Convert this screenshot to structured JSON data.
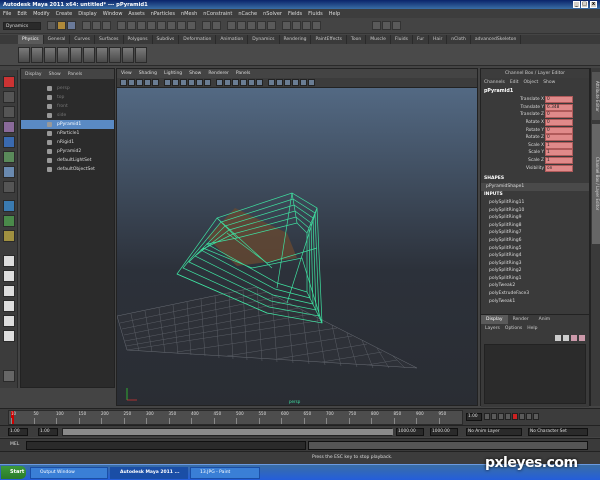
{
  "window": {
    "title": "Autodesk Maya 2011 x64: untitled*   ---   pPyramid1"
  },
  "menus": [
    "File",
    "Edit",
    "Modify",
    "Create",
    "Display",
    "Window",
    "Assets",
    "nParticles",
    "nMesh",
    "nConstraint",
    "nCache",
    "nSolver",
    "Fields",
    "Fluids",
    "Help"
  ],
  "statusline": {
    "mode": "Dynamics"
  },
  "shelf_tabs": [
    "General",
    "Curves",
    "Surfaces",
    "Polygons",
    "Subdivs",
    "Deformation",
    "Animation",
    "Dynamics",
    "Rendering",
    "PaintEffects",
    "Toon",
    "Muscle",
    "Fluids",
    "Fur",
    "Hair",
    "nCloth",
    "advancedSkeleton"
  ],
  "shelf_tabs_first": "Physics",
  "outliner": {
    "menu": [
      "Display",
      "Show",
      "Panels"
    ],
    "items": [
      {
        "label": "persp",
        "state": "dim"
      },
      {
        "label": "top",
        "state": "dim"
      },
      {
        "label": "front",
        "state": "dim"
      },
      {
        "label": "side",
        "state": "dim"
      },
      {
        "label": "pPyramid1",
        "state": "selected"
      },
      {
        "label": "nParticle1",
        "state": "normal"
      },
      {
        "label": "nRigid1",
        "state": "normal"
      },
      {
        "label": "pPyramid2",
        "state": "normal"
      },
      {
        "label": "defaultLightSet",
        "state": "normal"
      },
      {
        "label": "defaultObjectSet",
        "state": "normal"
      }
    ]
  },
  "viewport": {
    "menu": [
      "View",
      "Shading",
      "Lighting",
      "Show",
      "Renderer",
      "Panels"
    ],
    "camera_label": "persp"
  },
  "channel_box": {
    "header": "Channel Box / Layer Editor",
    "menu": [
      "Channels",
      "Edit",
      "Object",
      "Show"
    ],
    "object": "pPyramid1",
    "attributes": [
      {
        "name": "Translate X",
        "value": "0"
      },
      {
        "name": "Translate Y",
        "value": "6.348"
      },
      {
        "name": "Translate Z",
        "value": "0"
      },
      {
        "name": "Rotate X",
        "value": "0"
      },
      {
        "name": "Rotate Y",
        "value": "0"
      },
      {
        "name": "Rotate Z",
        "value": "0"
      },
      {
        "name": "Scale X",
        "value": "1"
      },
      {
        "name": "Scale Y",
        "value": "1"
      },
      {
        "name": "Scale Z",
        "value": "1"
      },
      {
        "name": "Visibility",
        "value": "on"
      }
    ],
    "shapes_label": "SHAPES",
    "shape": "pPyramidShape1",
    "inputs_label": "INPUTS",
    "inputs": [
      "polySplitRing11",
      "polySplitRing10",
      "polySplitRing9",
      "polySplitRing8",
      "polySplitRing7",
      "polySplitRing6",
      "polySplitRing5",
      "polySplitRing4",
      "polySplitRing3",
      "polySplitRing2",
      "polySplitRing1",
      "polyTweak2",
      "polyExtrudeFace3",
      "polyTweak1"
    ]
  },
  "layer_editor": {
    "tabs": [
      "Display",
      "Render",
      "Anim"
    ],
    "menu": [
      "Layers",
      "Options",
      "Help"
    ]
  },
  "side_tabs": [
    "Attribute Editor",
    "Channel Box / Layer Editor"
  ],
  "timeline": {
    "ticks": [
      "10",
      "50",
      "100",
      "150",
      "200",
      "250",
      "300",
      "350",
      "400",
      "450",
      "500",
      "550",
      "600",
      "650",
      "700",
      "750",
      "800",
      "850",
      "900",
      "950"
    ],
    "current_frame": "1.00",
    "range_start": "1.00",
    "range_start2": "1.00",
    "range_end": "1000.00",
    "range_end2": "1000.00",
    "anim_layer": "No Anim Layer",
    "character_set": "No Character Set"
  },
  "command_line": {
    "label": "MEL"
  },
  "help_line": {
    "text": "Press the ESC key to stop playback."
  },
  "taskbar": {
    "start": "Start",
    "tasks": [
      "Output Window",
      "Autodesk Maya 2011 ...",
      "13.JPG - Paint"
    ]
  },
  "watermark": "pxleyes.com",
  "colors": {
    "selection": "#5a8ac4",
    "keyed_attr": "#e08a8a",
    "wireframe": "#3fe0a0",
    "viewport_top": "#576f8b"
  }
}
